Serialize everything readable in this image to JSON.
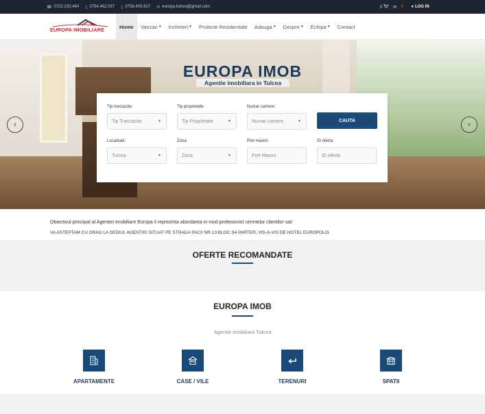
{
  "topbar": {
    "phone1": "0722.233.464",
    "phone2": "0754.462.037",
    "phone3": "0758.405.627",
    "email": "europa.tulcea@gmail.com",
    "cart_count": "0",
    "login_label": "LOG IN"
  },
  "logo": {
    "text": "EUROPA IMOBILIARE"
  },
  "menu": {
    "items": [
      {
        "label": "Home",
        "dropdown": false,
        "active": true
      },
      {
        "label": "Vanzari",
        "dropdown": true
      },
      {
        "label": "Inchirieri",
        "dropdown": true
      },
      {
        "label": "Proiecte Rezidentiale",
        "dropdown": false
      },
      {
        "label": "Adauga",
        "dropdown": true
      },
      {
        "label": "Despre",
        "dropdown": true
      },
      {
        "label": "Echipa",
        "dropdown": true
      },
      {
        "label": "Contact",
        "dropdown": false
      }
    ]
  },
  "hero": {
    "title": "EUROPA IMOB",
    "subtitle": "Agentie imobiliara in Tulcea"
  },
  "search": {
    "tip_tranzactie": {
      "label": "Tip tranzactie:",
      "value": "Tip Tranzactie"
    },
    "tip_proprietate": {
      "label": "Tip proprietate:",
      "value": "Tip Proprietate"
    },
    "numar_camere": {
      "label": "Numar camere:",
      "value": "Numar camere"
    },
    "button": "CAUTA",
    "localitate": {
      "label": "Localitate:",
      "value": "Tulcea"
    },
    "zona": {
      "label": "Zona:",
      "value": "Zona"
    },
    "pret_maxim": {
      "label": "Pret maxim:",
      "placeholder": "Pret Maxim"
    },
    "id_oferta": {
      "label": "ID oferta:",
      "placeholder": "ID oferta"
    }
  },
  "intro": {
    "line1": "Obiectivul principal al Agentiei Imobiliare Europa il reprezinta abordarea in mod profesionist cerintelor clientilor sai!",
    "line2": "VA ASTEPTAM CU DRAG LA SEDIUL AGENTIEI SITUAT PE STRADA PACII NR.13 BLOC S4 PARTER, VIS-A-VIS DE HOTEL EUROPOLIS"
  },
  "oferte": {
    "title": "OFERTE RECOMANDATE"
  },
  "about": {
    "title": "EUROPA IMOB",
    "subtitle": "Agentie imobiliara Tulcea",
    "categories": [
      {
        "label": "APARTAMENTE",
        "icon": "building-icon"
      },
      {
        "label": "CASE / VILE",
        "icon": "house-icon"
      },
      {
        "label": "TERENURI",
        "icon": "arrow-left-icon"
      },
      {
        "label": "SPATII",
        "icon": "storefront-icon"
      }
    ]
  },
  "colors": {
    "brand_dark": "#1a4a78",
    "topbar": "#1e2530",
    "logo_red": "#c62828"
  }
}
